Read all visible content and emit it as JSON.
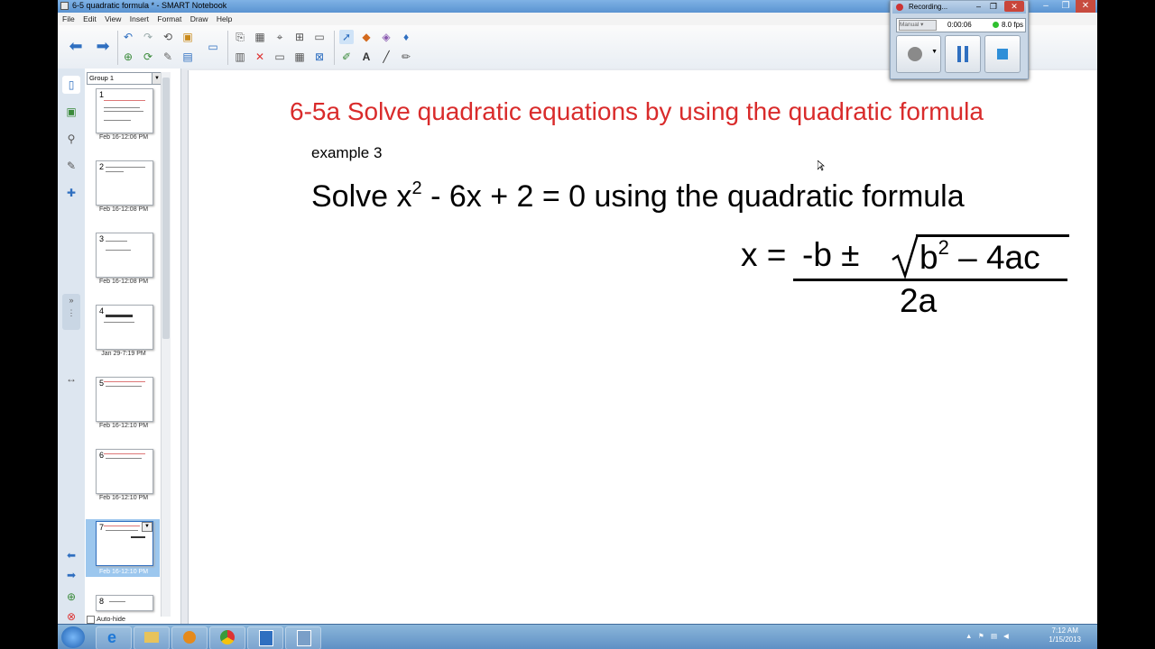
{
  "window": {
    "title": "6-5 quadratic formula * - SMART Notebook",
    "controls": [
      "–",
      "❐",
      "✕"
    ]
  },
  "menu": [
    "File",
    "Edit",
    "View",
    "Insert",
    "Format",
    "Draw",
    "Help"
  ],
  "pages_panel": {
    "group_label": "Group 1",
    "autohide_label": "Auto-hide",
    "pages": [
      {
        "num": "1",
        "date": "Feb 16-12:06 PM"
      },
      {
        "num": "2",
        "date": "Feb 16-12:08 PM"
      },
      {
        "num": "3",
        "date": "Feb 16-12:08 PM"
      },
      {
        "num": "4",
        "date": "Jan 29-7:19 PM"
      },
      {
        "num": "5",
        "date": "Feb 16-12:10 PM"
      },
      {
        "num": "6",
        "date": "Feb 16-12:10 PM"
      },
      {
        "num": "7",
        "date": "Feb 16-12:10 PM"
      },
      {
        "num": "8",
        "date": ""
      }
    ],
    "selected_page": "7"
  },
  "slide": {
    "title": "6-5a Solve quadratic equations by using the quadratic formula",
    "example": "example 3",
    "problem_prefix": "Solve x",
    "problem_exp": "2",
    "problem_suffix": " - 6x + 2 = 0 using the quadratic formula",
    "formula_lhs": "x =",
    "formula_num_a": "-b ± ",
    "formula_num_b": "b",
    "formula_num_exp": "2",
    "formula_num_c": " – 4ac",
    "formula_den": "2a"
  },
  "recorder": {
    "title": "Recording...",
    "mode": "Manual",
    "time": "0:00:06",
    "fps": "8.0 fps"
  },
  "taskbar": {
    "clock_time": "7:12 AM",
    "clock_date": "1/15/2013"
  },
  "colors": {
    "title_red": "#d92b2b",
    "selected_page": "#9cc7ee"
  }
}
